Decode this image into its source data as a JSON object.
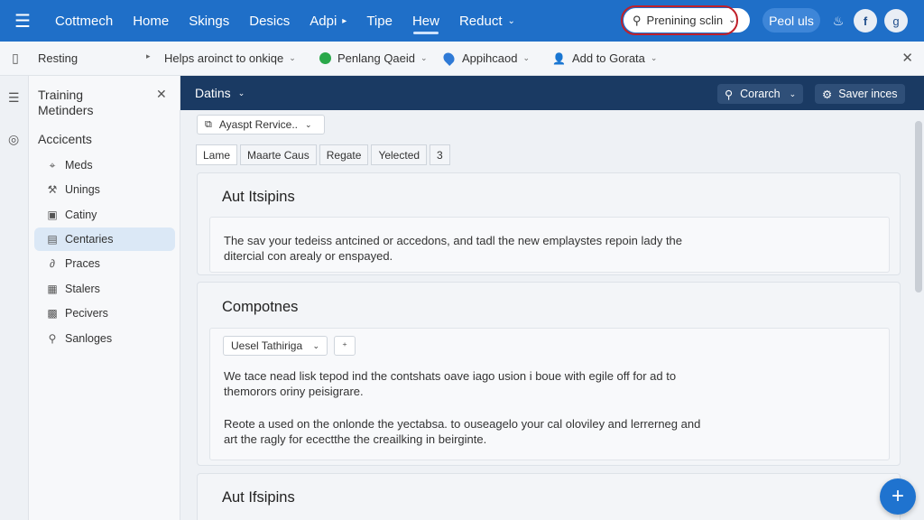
{
  "topnav": {
    "menu_icon": "hamburger-icon",
    "items": [
      {
        "label": "Cottmech"
      },
      {
        "label": "Home"
      },
      {
        "label": "Skings"
      },
      {
        "label": "Desics"
      },
      {
        "label": "Adpi",
        "suffix": "▸"
      },
      {
        "label": "Tipe"
      },
      {
        "label": "Hew",
        "active": true
      },
      {
        "label": "Reduct",
        "suffix": "⌄"
      }
    ],
    "search_value": "Prenining sclin",
    "button_label": "Peol uls",
    "bell_icon": "bell-icon",
    "avatar_f": "f",
    "avatar_g": "g"
  },
  "toolbar": {
    "items": [
      "Resting",
      "Helps aroinct to onkiqe",
      "Penlang Qaeid",
      "Appihcaod",
      "Add to Gorata"
    ],
    "close_icon": "close-icon"
  },
  "sidebar": {
    "title": "Training Metinders",
    "section": "Accicents",
    "items": [
      {
        "label": "Meds",
        "icon": "pin-icon"
      },
      {
        "label": "Unings",
        "icon": "tools-icon"
      },
      {
        "label": "Catiny",
        "icon": "calendar-icon"
      },
      {
        "label": "Centaries",
        "icon": "document-icon",
        "active": true
      },
      {
        "label": "Praces",
        "icon": "link-icon"
      },
      {
        "label": "Stalers",
        "icon": "clipboard-icon"
      },
      {
        "label": "Pecivers",
        "icon": "gallery-icon"
      },
      {
        "label": "Sanloges",
        "icon": "search-icon"
      }
    ]
  },
  "main": {
    "header_title": "Datins",
    "header_btn1": "Corarch",
    "header_btn2": "Saver inces",
    "filter_value": "Ayaspt  Rervice..",
    "tabs": [
      "Lame",
      "Maarte Caus",
      "Regate",
      "Yelected",
      "3"
    ],
    "cards": [
      {
        "title": "Aut Itsipins",
        "paragraphs": [
          "The sav your tedeiss antcined or accedons, and tadl the new emplaystes repoin lady the ditercial con arealy or enspayed."
        ]
      },
      {
        "title": "Compotnes",
        "select_value": "Uesel Tathiriga",
        "paragraphs": [
          "We tace nead lisk tepod ind  the contshats oave iago usion i boue with egile off for ad to themorors oriny peisigrare.",
          "Reote a used on the onlonde the yectabsa. to ouseagelo your cal oloviley and lerrerneg and art the ragly for ecectthe the creailking in beirginte."
        ]
      },
      {
        "title": "Aut Ifsipins"
      }
    ]
  },
  "colors": {
    "topnav_bg": "#1f6fc8",
    "main_header_bg": "#1a3a63",
    "highlight_ring": "#c0202a",
    "fab": "#1f73cf"
  }
}
